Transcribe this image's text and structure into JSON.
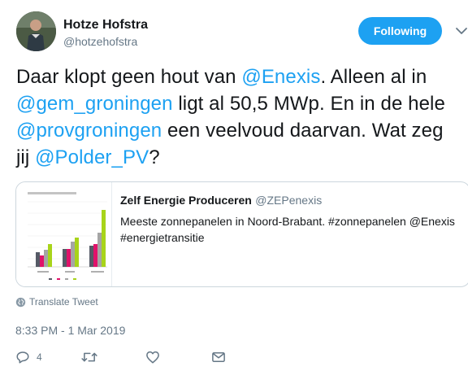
{
  "author": {
    "display_name": "Hotze Hofstra",
    "handle": "@hotzehofstra"
  },
  "follow_button": {
    "label": "Following"
  },
  "tweet": {
    "segments": [
      {
        "text": "Daar klopt geen hout van ",
        "mention": false
      },
      {
        "text": "@Enexis",
        "mention": true
      },
      {
        "text": ". Alleen al in ",
        "mention": false
      },
      {
        "text": "@gem_groningen",
        "mention": true
      },
      {
        "text": " ligt al 50,5 MWp. En in de hele ",
        "mention": false
      },
      {
        "text": "@provgroningen",
        "mention": true
      },
      {
        "text": " een veelvoud daarvan. Wat zeg jij ",
        "mention": false
      },
      {
        "text": "@Polder_PV",
        "mention": true
      },
      {
        "text": "?",
        "mention": false
      }
    ]
  },
  "quoted_tweet": {
    "display_name": "Zelf Energie Produceren",
    "handle": "@ZEPenexis",
    "text": "Meeste zonnepanelen in Noord-Brabant. #zonnepanelen @Enexis #energietransitie"
  },
  "translate": {
    "label": "Translate Tweet"
  },
  "timestamp": "8:33 PM - 1 Mar 2019",
  "actions": {
    "reply_count": "4"
  },
  "colors": {
    "accent": "#1da1f2",
    "text": "#14171a",
    "secondary": "#657786"
  },
  "icons": {
    "reply": "reply-icon",
    "retweet": "retweet-icon",
    "like": "heart-icon",
    "dm": "envelope-icon",
    "translate": "globe-icon",
    "more": "chevron-down-icon"
  }
}
